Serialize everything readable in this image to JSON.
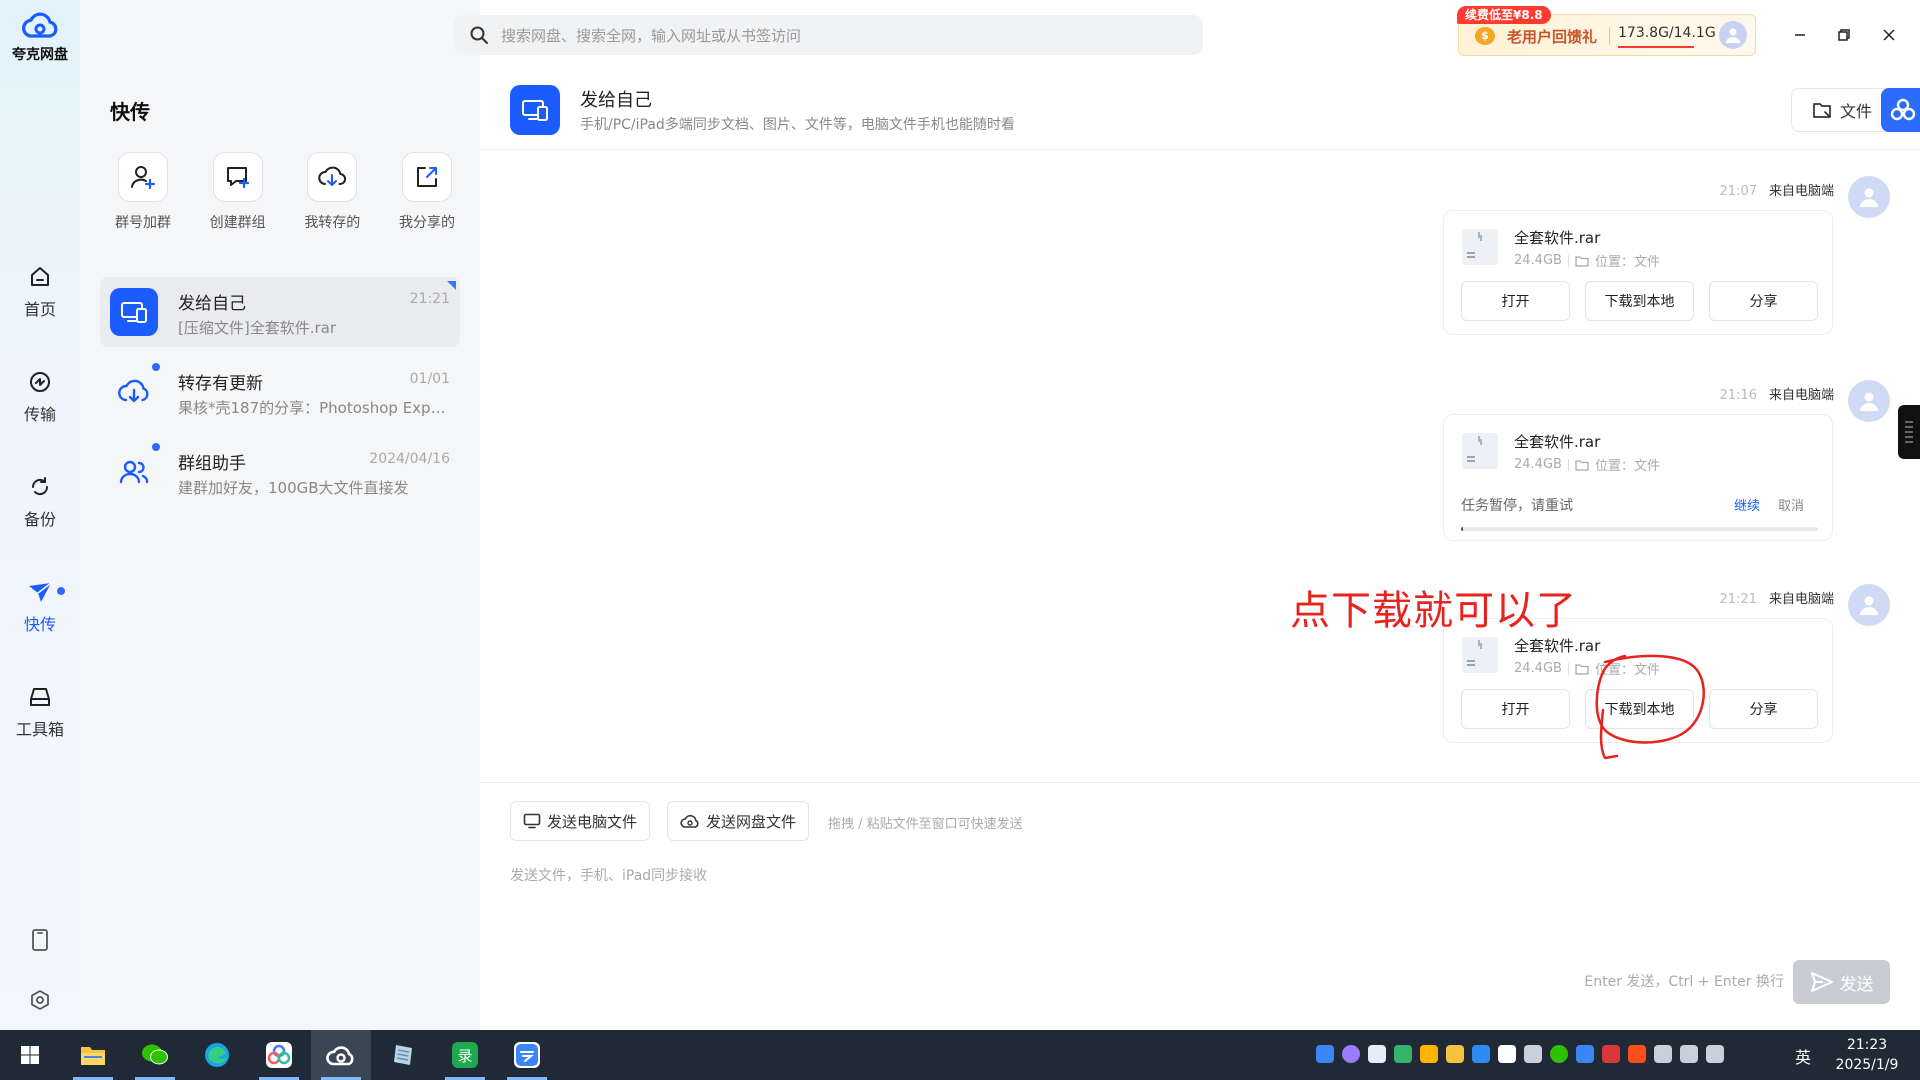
{
  "app": {
    "name": "夸克网盘"
  },
  "rail": {
    "items": [
      {
        "label": "首页"
      },
      {
        "label": "传输"
      },
      {
        "label": "备份"
      },
      {
        "label": "快传"
      },
      {
        "label": "工具箱"
      }
    ]
  },
  "search": {
    "placeholder": "搜索网盘、搜索全网，输入网址或从书签访问"
  },
  "promo": {
    "tag": "续费低至¥8.8",
    "text": "老用户回馈礼",
    "storage": "173.8G/14.1G"
  },
  "panel": {
    "title": "快传",
    "actions": [
      {
        "label": "群号加群"
      },
      {
        "label": "创建群组"
      },
      {
        "label": "我转存的"
      },
      {
        "label": "我分享的"
      }
    ],
    "conversations": [
      {
        "name": "发给自己",
        "time": "21:21",
        "preview": "[压缩文件]全套软件.rar"
      },
      {
        "name": "转存有更新",
        "time": "01/01",
        "preview": "果核*壳187的分享：Photoshop Expr..."
      },
      {
        "name": "群组助手",
        "time": "2024/04/16",
        "preview": "建群加好友，100GB大文件直接发"
      }
    ]
  },
  "chat": {
    "title": "发给自己",
    "subtitle": "手机/PC/iPad多端同步文档、图片、文件等，电脑文件手机也能随时看",
    "file_button": "文件",
    "messages": [
      {
        "time": "21:07",
        "source": "来自电脑端",
        "file": "全套软件.rar",
        "size": "24.4GB",
        "location": "位置：文件",
        "buttons": [
          "打开",
          "下载到本地",
          "分享"
        ]
      },
      {
        "time": "21:16",
        "source": "来自电脑端",
        "file": "全套软件.rar",
        "size": "24.4GB",
        "location": "位置：文件",
        "status": "任务暂停，请重试",
        "resume": "继续",
        "cancel": "取消",
        "progress": 0.003
      },
      {
        "time": "21:21",
        "source": "来自电脑端",
        "file": "全套软件.rar",
        "size": "24.4GB",
        "location": "位置：文件",
        "buttons": [
          "打开",
          "下载到本地",
          "分享"
        ]
      }
    ],
    "annotation": "点下载就可以了"
  },
  "composer": {
    "send_pc": "发送电脑文件",
    "send_cloud": "发送网盘文件",
    "hint": "拖拽 / 粘贴文件至窗口可快速发送",
    "placeholder": "发送文件，手机、iPad同步接收",
    "kb_hint": "Enter 发送，Ctrl + Enter 换行",
    "send": "发送"
  },
  "taskbar": {
    "ime": "英",
    "time": "21:23",
    "date": "2025/1/9"
  },
  "colors": {
    "accent": "#1a5cff",
    "annotation": "#e8231d",
    "promo": "#ff3b30"
  }
}
